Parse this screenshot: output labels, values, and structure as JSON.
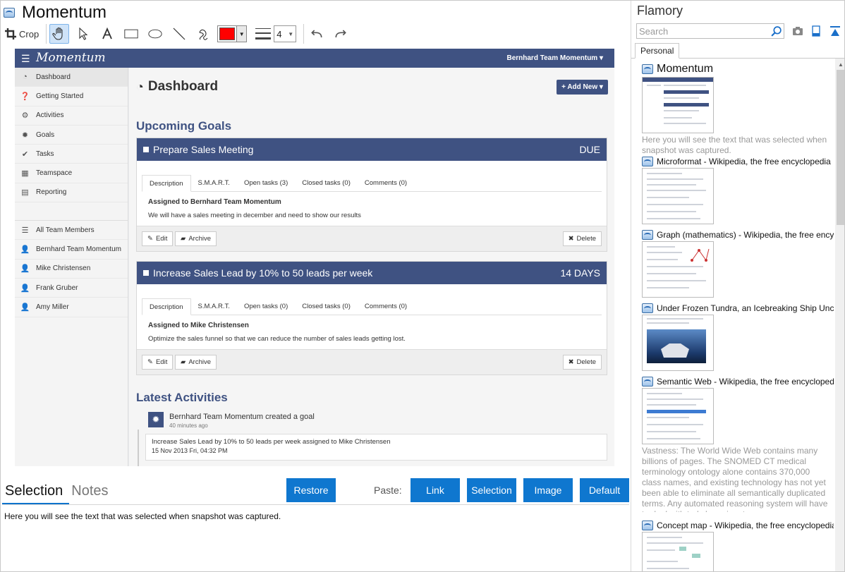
{
  "window": {
    "title": "Momentum"
  },
  "toolbar": {
    "crop_label": "Crop",
    "line_width": "4",
    "pen_color": "#ff0000"
  },
  "snapshot": {
    "brand": "Momentum",
    "user_menu": "Bernhard Team Momentum ▾",
    "page_title": "Dashboard",
    "add_new": "+ Add New ▾",
    "nav": [
      {
        "label": "Dashboard",
        "icon": "dashboard-icon"
      },
      {
        "label": "Getting Started",
        "icon": "question-icon"
      },
      {
        "label": "Activities",
        "icon": "gears-icon"
      },
      {
        "label": "Goals",
        "icon": "badge-icon"
      },
      {
        "label": "Tasks",
        "icon": "check-circle-icon"
      },
      {
        "label": "Teamspace",
        "icon": "grid-icon"
      },
      {
        "label": "Reporting",
        "icon": "report-icon"
      }
    ],
    "team": [
      {
        "label": "All Team Members",
        "icon": "list-icon"
      },
      {
        "label": "Bernhard Team Momentum",
        "icon": "user-icon"
      },
      {
        "label": "Mike Christensen",
        "icon": "user-icon"
      },
      {
        "label": "Frank Gruber",
        "icon": "user-icon"
      },
      {
        "label": "Amy Miller",
        "icon": "user-icon"
      }
    ],
    "upcoming_title": "Upcoming Goals",
    "goal_tab_labels": [
      "Description",
      "S.M.A.R.T.",
      "Open tasks (3)",
      "Closed tasks (0)",
      "Comments (0)",
      "Open tasks (0)"
    ],
    "goals": [
      {
        "name": "Prepare Sales Meeting",
        "due": "DUE",
        "assigned": "Assigned to Bernhard Team Momentum",
        "description": "We will have a sales meeting in december and need to show our results"
      },
      {
        "name": "Increase Sales Lead by 10% to 50 leads per week",
        "due": "14 DAYS",
        "assigned": "Assigned to Mike Christensen",
        "description": "Optimize the sales funnel so that we can reduce the number of sales leads getting lost."
      }
    ],
    "actions": {
      "edit": "Edit",
      "archive": "Archive",
      "delete": "Delete"
    },
    "latest_title": "Latest Activities",
    "activity": {
      "who": "Bernhard Team Momentum created a goal",
      "when": "40 minutes ago",
      "text": "Increase Sales Lead by 10% to 50 leads per week assigned to Mike Christensen",
      "date": "15 Nov 2013 Fri, 04:32 PM"
    }
  },
  "bottom": {
    "tabs": [
      "Selection",
      "Notes"
    ],
    "restore": "Restore",
    "paste_label": "Paste:",
    "paste_buttons": [
      "Link",
      "Selection",
      "Image",
      "Default"
    ],
    "selection_text": "Here you will see the text that was selected when snapshot was captured."
  },
  "flamory": {
    "title": "Flamory",
    "search_placeholder": "Search",
    "tab": "Personal",
    "items": [
      {
        "title": "Momentum",
        "note": "Here you will see the text that was selected when snapshot was captured."
      },
      {
        "title": "Microformat - Wikipedia, the free encyclopedia",
        "note": ""
      },
      {
        "title": "Graph (mathematics) - Wikipedia, the free encyclopedia",
        "note": ""
      },
      {
        "title": "Under Frozen Tundra, an Icebreaking Ship Uncovers",
        "note": ""
      },
      {
        "title": "Semantic Web - Wikipedia, the free encyclopedia",
        "note": "Vastness: The World Wide Web contains many billions of pages. The SNOMED CT medical terminology ontology alone contains 370,000 class names, and existing technology has not yet been able to eliminate all semantically duplicated terms. Any automated reasoning system will have to deal with truly huge inputs."
      },
      {
        "title": "Concept map - Wikipedia, the free encyclopedia",
        "note": ""
      }
    ]
  }
}
